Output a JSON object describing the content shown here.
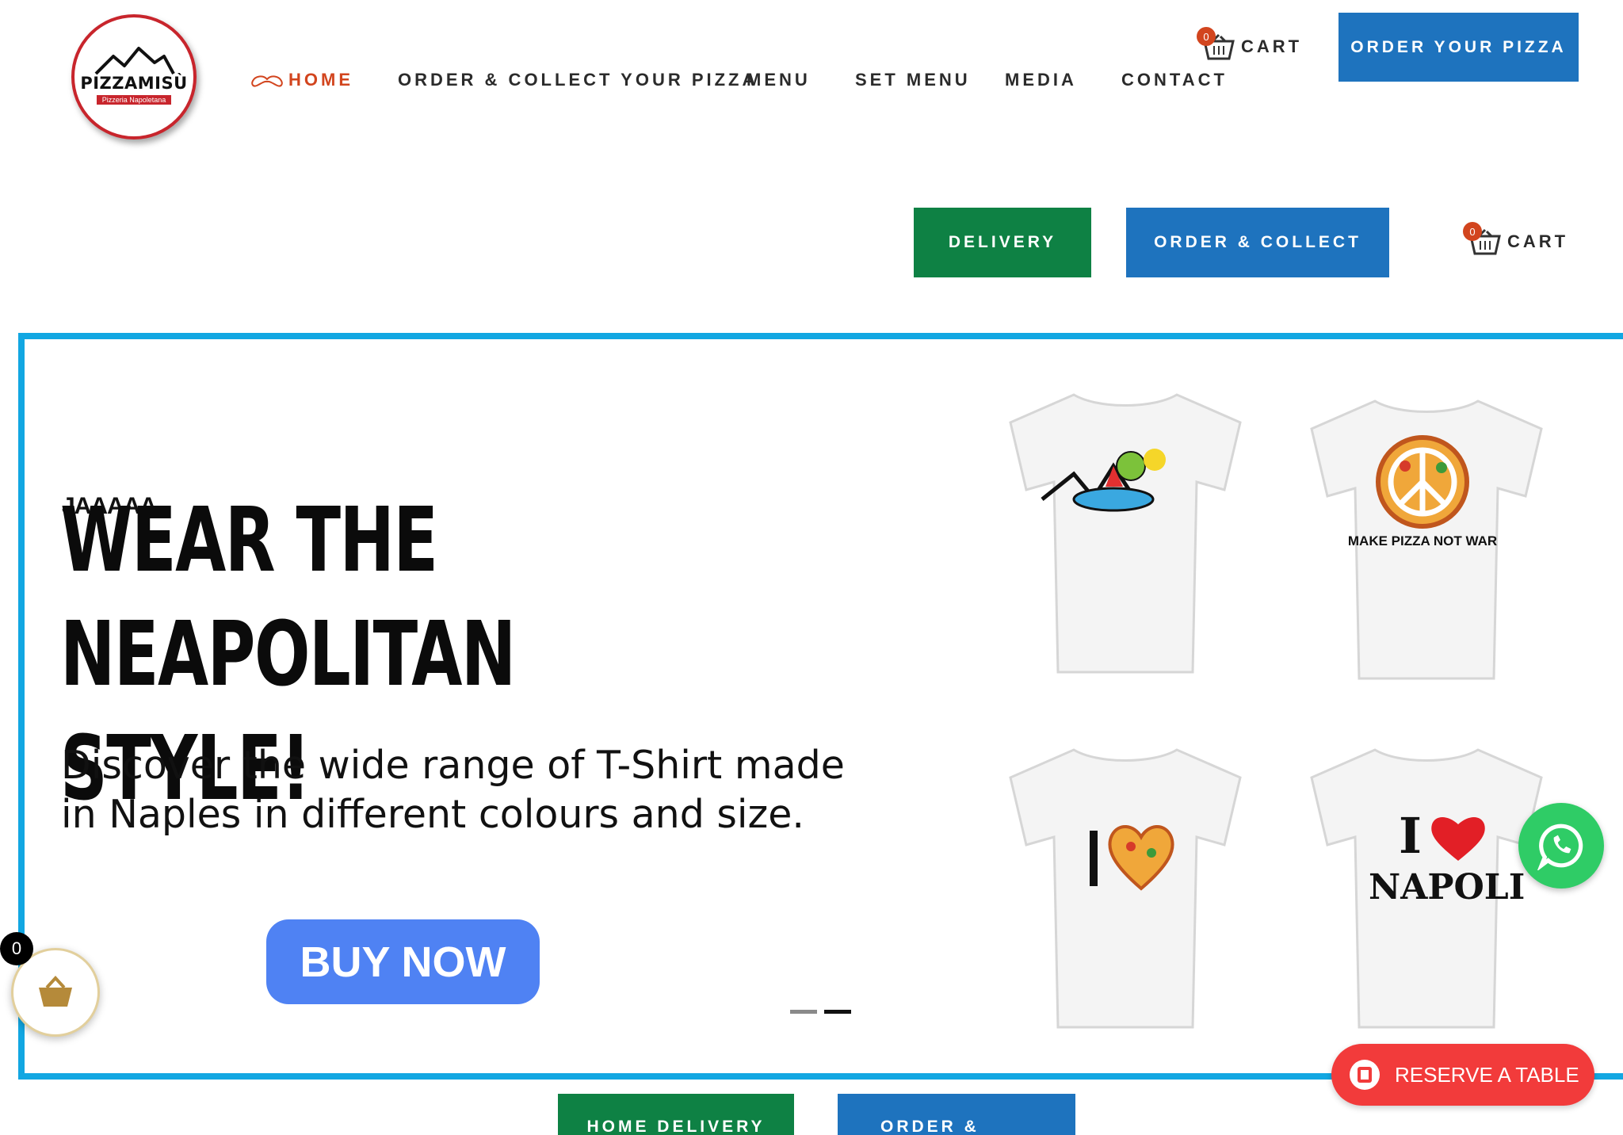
{
  "logo": {
    "brand": "PIZZAMISÙ",
    "tagline": "Pizzeria Napoletana"
  },
  "nav": {
    "items": [
      {
        "label": "HOME",
        "active": true
      },
      {
        "label": "ORDER & COLLECT YOUR PIZZA"
      },
      {
        "label": "MENU"
      },
      {
        "label": "SET MENU"
      },
      {
        "label": "MEDIA"
      },
      {
        "label": "CONTACT"
      }
    ]
  },
  "header_cart": {
    "count": "0",
    "label": "CART"
  },
  "order_button": "ORDER YOUR PIZZA",
  "subheader": {
    "delivery": "DELIVERY",
    "order_collect": "ORDER & COLLECT",
    "cart_count": "0",
    "cart_label": "CART"
  },
  "hero": {
    "kicker": "JAAAAA",
    "headline_line1": "WEAR THE NEAPOLITAN",
    "headline_line2": "STYLE!",
    "subtext": "Discover the wide range of T-Shirt made in Naples in different colours and size.",
    "cta": "BUY NOW",
    "slide_count": 2,
    "active_slide": 2
  },
  "shirts": [
    {
      "icon": "napoli-vesuvio-shirt-image"
    },
    {
      "icon": "make-pizza-not-war-shirt-image",
      "print": "MAKE PIZZA NOT WAR"
    },
    {
      "icon": "heart-pizza-shirt-image"
    },
    {
      "icon": "i-love-napoli-shirt-image",
      "print_top": "I",
      "print_bottom": "NAPOLI"
    }
  ],
  "floating_cart": {
    "count": "0"
  },
  "reserve": {
    "label": "RESERVE A TABLE"
  },
  "bottom_buttons": {
    "home_delivery": "HOME DELIVERY",
    "order_collect": "ORDER &"
  },
  "colors": {
    "accent": "#d2451e",
    "blue": "#1e73be",
    "green": "#0e8144",
    "hero_border": "#12a7e2",
    "cta": "#4f82f3",
    "whatsapp": "#2fcc66",
    "reserve": "#f23b3b"
  }
}
